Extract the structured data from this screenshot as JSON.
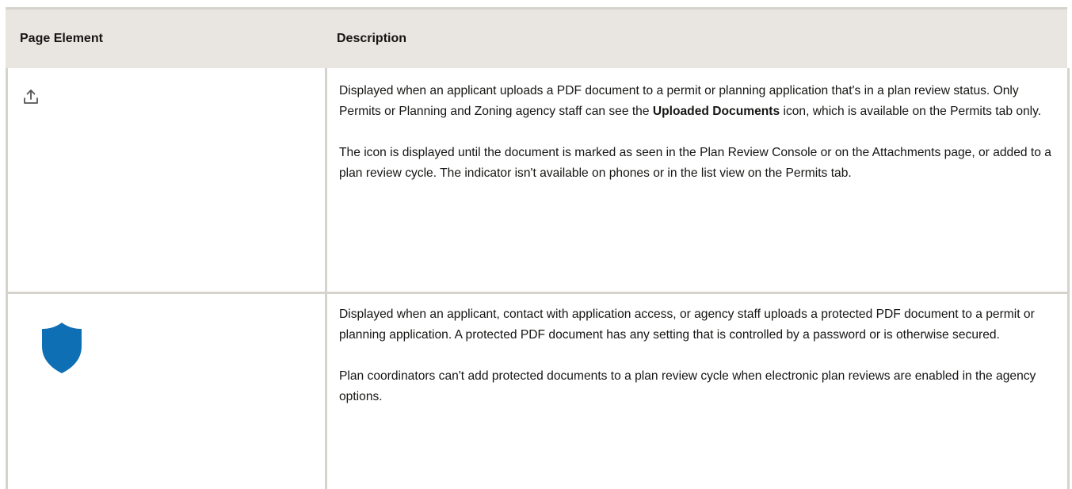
{
  "table": {
    "headers": {
      "col1": "Page Element",
      "col2": "Description"
    },
    "rows": [
      {
        "icon": "upload-icon",
        "paragraphs": [
          {
            "before": "Displayed when an applicant uploads a PDF document to a permit or planning application that's in a plan review status. Only Permits or Planning and Zoning agency staff can see the ",
            "bold": "Uploaded Documents",
            "after": " icon, which is available on the Permits tab only."
          },
          {
            "text": "The icon is displayed until the document is marked as seen in the Plan Review Console or on the Attachments page, or added to a plan review cycle. The indicator isn't available on phones or in the list view on the Permits tab."
          }
        ]
      },
      {
        "icon": "shield-icon",
        "paragraphs": [
          {
            "text": "Displayed when an applicant, contact with application access, or agency staff uploads a protected PDF document to a permit or planning application. A protected PDF document has any setting that is controlled by a password or is otherwise secured."
          },
          {
            "text": "Plan coordinators can't add protected documents to a plan review cycle when electronic plan reviews are enabled in the agency options."
          }
        ]
      }
    ]
  },
  "colors": {
    "header_bg": "#e9e6e1",
    "border": "#d6d3cd",
    "shield": "#0f6fb4",
    "text": "#161513"
  }
}
